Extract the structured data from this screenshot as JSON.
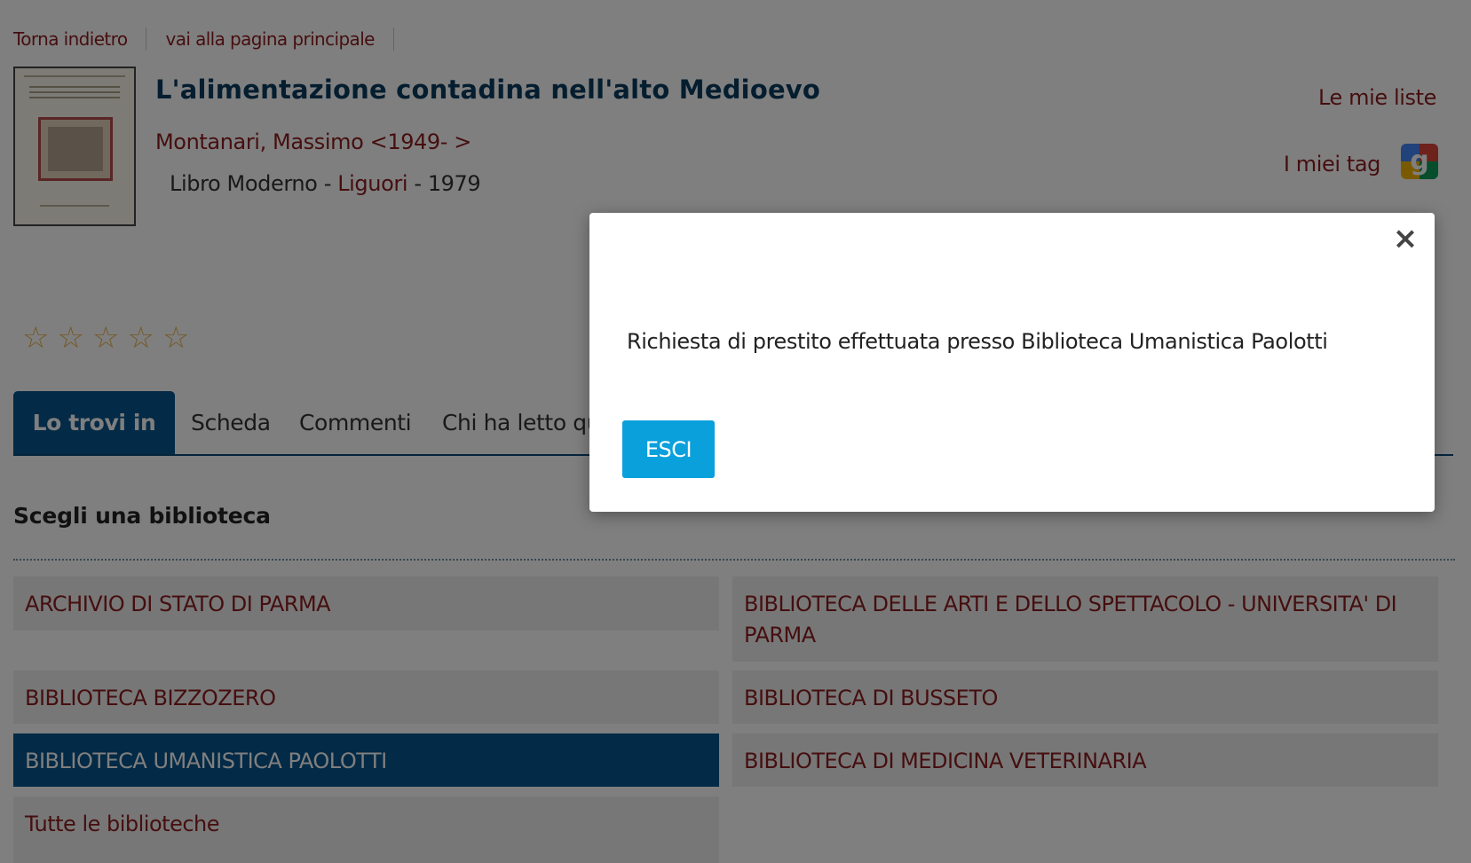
{
  "nav": {
    "back": "Torna indietro",
    "home": "vai alla pagina principale"
  },
  "book": {
    "title": "L'alimentazione contadina nell'alto Medioevo",
    "author": "Montanari, Massimo <1949- >",
    "type": "Libro Moderno",
    "sep1": " - ",
    "publisher": "Liguori",
    "sep2": " - ",
    "year": "1979"
  },
  "sidebar": {
    "lists": "Le mie liste",
    "tags": "I miei tag"
  },
  "rating": {
    "stars": [
      "☆",
      "☆",
      "☆",
      "☆",
      "☆"
    ],
    "value": 0,
    "max": 5
  },
  "tabs": [
    "Lo trovi in",
    "Scheda",
    "Commenti",
    "Chi ha letto questo ha letto anche"
  ],
  "libraries": {
    "heading": "Scegli una biblioteca",
    "items": [
      "ARCHIVIO DI STATO DI PARMA",
      "BIBLIOTECA DELLE ARTI E DELLO SPETTACOLO - UNIVERSITA' DI PARMA",
      "BIBLIOTECA BIZZOZERO",
      "BIBLIOTECA DI BUSSETO",
      "BIBLIOTECA UMANISTICA PAOLOTTI",
      "BIBLIOTECA DI MEDICINA VETERINARIA",
      "Tutte le biblioteche"
    ],
    "selected": "BIBLIOTECA UMANISTICA PAOLOTTI"
  },
  "modal": {
    "close": "×",
    "message": "Richiesta di prestito effettuata presso Biblioteca Umanistica Paolotti",
    "button": "ESCI"
  },
  "colors": {
    "link": "#8d1d1f",
    "primary": "#06548c",
    "button": "#0aa0dc",
    "title": "#093a5f"
  }
}
